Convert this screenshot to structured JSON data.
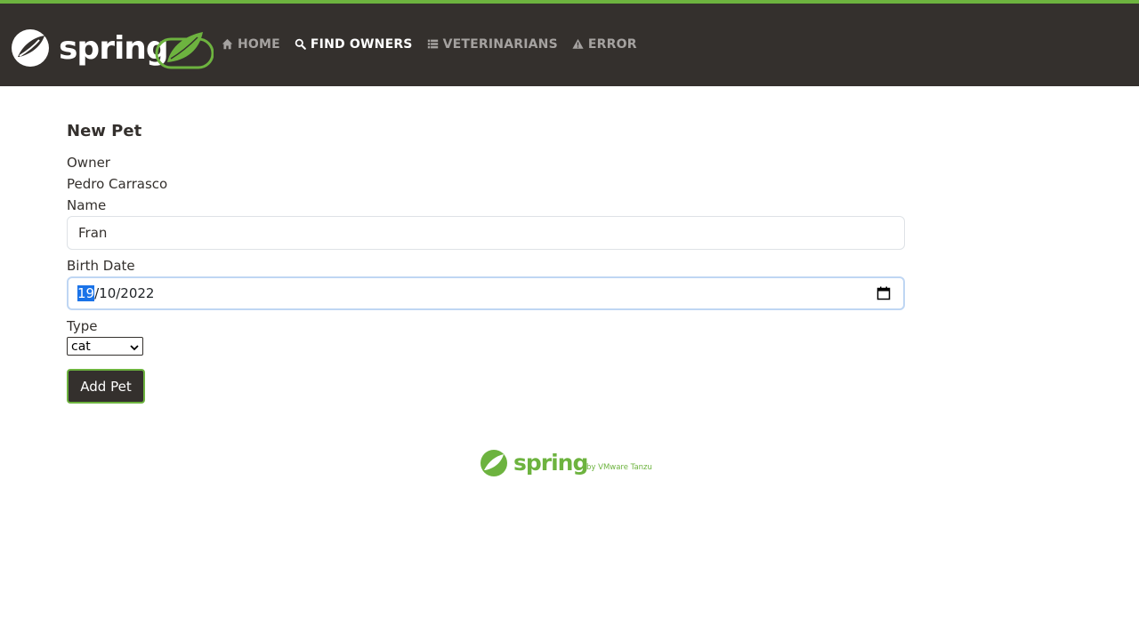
{
  "nav": {
    "brand": "spring",
    "items": [
      {
        "label": "Home",
        "icon": "home-icon"
      },
      {
        "label": "Find owners",
        "icon": "search-icon"
      },
      {
        "label": "Veterinarians",
        "icon": "list-icon"
      },
      {
        "label": "Error",
        "icon": "warning-icon"
      }
    ],
    "active_index": 1
  },
  "form": {
    "title": "New Pet",
    "owner_label": "Owner",
    "owner_value": "Pedro Carrasco",
    "name_label": "Name",
    "name_value": "Fran",
    "birth_label": "Birth Date",
    "birth_day": "19",
    "birth_rest": "/10/2022",
    "type_label": "Type",
    "type_value": "cat",
    "submit_label": "Add Pet"
  },
  "footer": {
    "brand": "spring",
    "tagline": "by VMware Tanzu"
  },
  "colors": {
    "brand_green": "#6db33f",
    "navbar_bg": "#34302d",
    "text": "#34302d"
  }
}
